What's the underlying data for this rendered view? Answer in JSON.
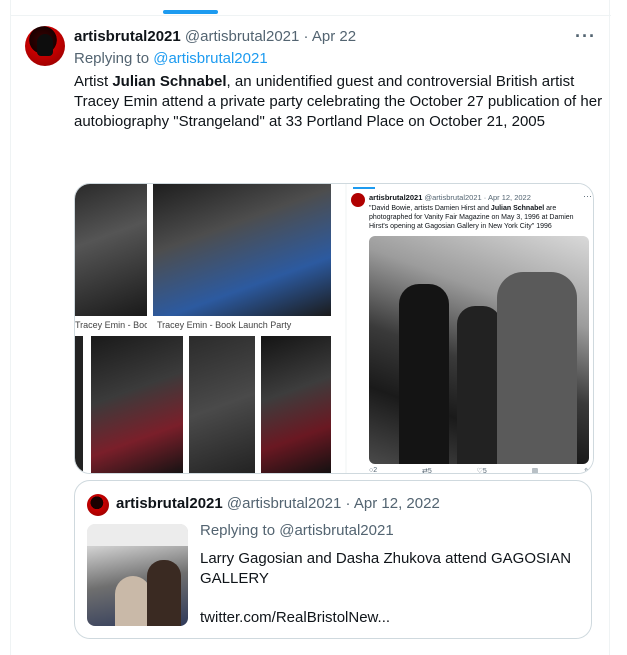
{
  "tweet": {
    "display_name": "artisbrutal2021",
    "handle": "@artisbrutal2021",
    "separator": "·",
    "date": "Apr 22",
    "more": "···",
    "replying_prefix": "Replying to",
    "replying_handle": "@artisbrutal2021",
    "text_before": "Artist ",
    "text_bold": "Julian Schnabel",
    "text_after": ", an unidentified guest and controversial British artist Tracey Emin attend a private party celebrating the October 27 publication of her autobiography \"Strangeland\" at 33 Portland Place on October 21, 2005"
  },
  "media": {
    "caption_1": "Tracey Emin - Boo...",
    "caption_2": "Tracey Emin - Book Launch Party",
    "embedded": {
      "display_name": "artisbrutal2021",
      "handle_date": "@artisbrutal2021 · Apr 12, 2022",
      "more": "···",
      "text_before": "\"David Bowie, artists Damien Hirst and ",
      "text_bold": "Julian Schnabel",
      "text_after": " are photographed for Vanity Fair Magazine on May 3, 1996 at Damien Hirst's opening at Gagosian Gallery in New York City\" 1996",
      "actions": [
        "2",
        "5",
        "5",
        "",
        "",
        ""
      ]
    }
  },
  "quote": {
    "display_name": "artisbrutal2021",
    "handle": "@artisbrutal2021",
    "separator": "·",
    "date": "Apr 12, 2022",
    "replying": "Replying to @artisbrutal2021",
    "text": "Larry Gagosian and Dasha Zhukova attend GAGOSIAN GALLERY",
    "link": "twitter.com/RealBristolNew..."
  }
}
